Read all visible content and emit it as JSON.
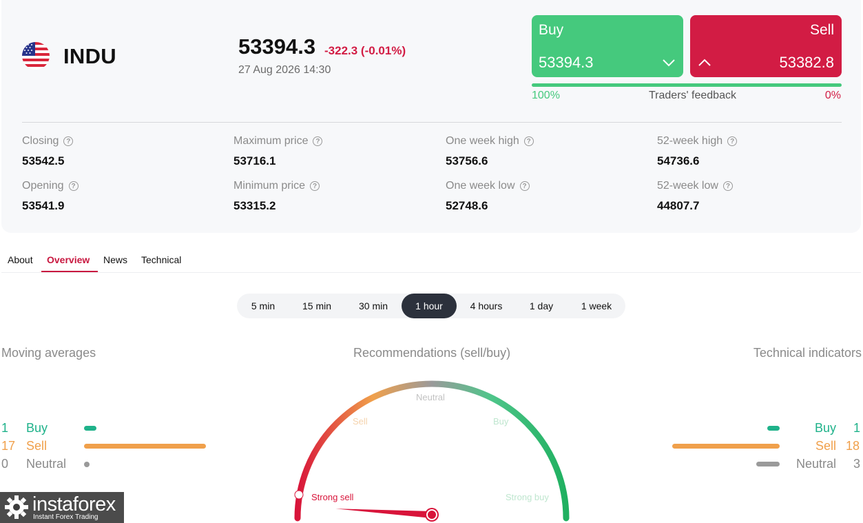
{
  "instrument": {
    "symbol": "INDU",
    "flag_icon": "us-flag-icon",
    "price": "53394.3",
    "change": "-322.3 (-0.01%)",
    "datetime": "27 Aug 2026 14:30"
  },
  "trade": {
    "buy_label": "Buy",
    "buy_price": "53394.3",
    "sell_label": "Sell",
    "sell_price": "53382.8",
    "buy_color": "#45c97d",
    "sell_color": "#d21c44"
  },
  "feedback": {
    "label": "Traders' feedback",
    "buy_percent": "100%",
    "sell_percent": "0%",
    "buy_fraction": 1.0
  },
  "stats": {
    "closing": {
      "label": "Closing",
      "value": "53542.5"
    },
    "opening": {
      "label": "Opening",
      "value": "53541.9"
    },
    "max_price": {
      "label": "Maximum price",
      "value": "53716.1"
    },
    "min_price": {
      "label": "Minimum price",
      "value": "53315.2"
    },
    "week_high": {
      "label": "One week high",
      "value": "53756.6"
    },
    "week_low": {
      "label": "One week low",
      "value": "52748.6"
    },
    "year_high": {
      "label": "52-week high",
      "value": "54736.6"
    },
    "year_low": {
      "label": "52-week low",
      "value": "44807.7"
    }
  },
  "tabs": [
    {
      "label": "About"
    },
    {
      "label": "Overview",
      "active": true
    },
    {
      "label": "News"
    },
    {
      "label": "Technical"
    }
  ],
  "timeframes": [
    {
      "label": "5 min"
    },
    {
      "label": "15 min"
    },
    {
      "label": "30 min"
    },
    {
      "label": "1 hour",
      "active": true
    },
    {
      "label": "4 hours"
    },
    {
      "label": "1 day"
    },
    {
      "label": "1 week"
    }
  ],
  "moving_averages": {
    "title": "Moving averages",
    "buy": {
      "count": "1",
      "label": "Buy"
    },
    "sell": {
      "count": "17",
      "label": "Sell"
    },
    "neutral": {
      "count": "0",
      "label": "Neutral"
    }
  },
  "technical_indicators": {
    "title": "Technical indicators",
    "buy": {
      "count": "1",
      "label": "Buy"
    },
    "sell": {
      "count": "18",
      "label": "Sell"
    },
    "neutral": {
      "count": "3",
      "label": "Neutral"
    }
  },
  "recommendations": {
    "title": "Recommendations (sell/buy)",
    "labels": {
      "strong_sell": "Strong sell",
      "sell": "Sell",
      "neutral": "Neutral",
      "buy": "Buy",
      "strong_buy": "Strong buy"
    },
    "needle_value": 0.02
  },
  "colors": {
    "accent": "#c8173f",
    "ma_buy": "#1fb28a",
    "ma_sell": "#f0a04b",
    "neutral": "#9a9a9a"
  },
  "logo": {
    "name": "instaforex",
    "tagline": "Instant Forex Trading"
  }
}
